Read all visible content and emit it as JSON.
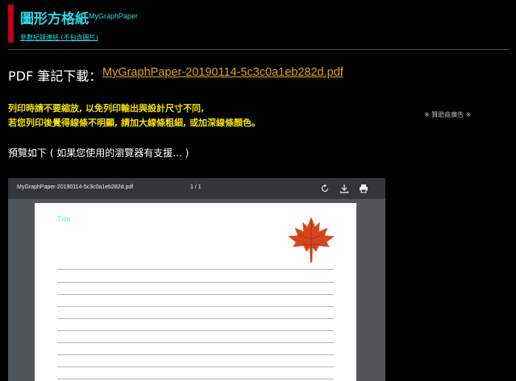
{
  "site": {
    "title": "圖形方格紙",
    "subtitle": "MyGraphPaper",
    "params_link": "參數紀錄連結 (不包含圖片)"
  },
  "download": {
    "label": "PDF 筆記下載：",
    "filename": "MyGraphPaper-20190114-5c3c0a1eb282d.pdf"
  },
  "notice": {
    "line1": "列印時請不要縮放, 以免列印輸出與設計尺寸不同,",
    "line2": "若您列印後覺得線條不明顯, 請加大線條粗細, 或加深線條顏色。"
  },
  "ad_note": "※ 贊助商廣告 ※",
  "preview_label": "預覽如下 ( 如果您使用的瀏覽器有支援... )",
  "viewer": {
    "filename": "MyGraphPaper-20190114-5c3c0a1eb282d.pdf",
    "page_indicator": "1 / 1",
    "icons": [
      "rotate-icon",
      "download-icon",
      "print-icon"
    ],
    "page_title_label": "Title :"
  },
  "colors": {
    "accent": "#2ad8e6",
    "brand_bar": "#c0001a",
    "link": "#e0a418",
    "warning": "#f0e000"
  }
}
